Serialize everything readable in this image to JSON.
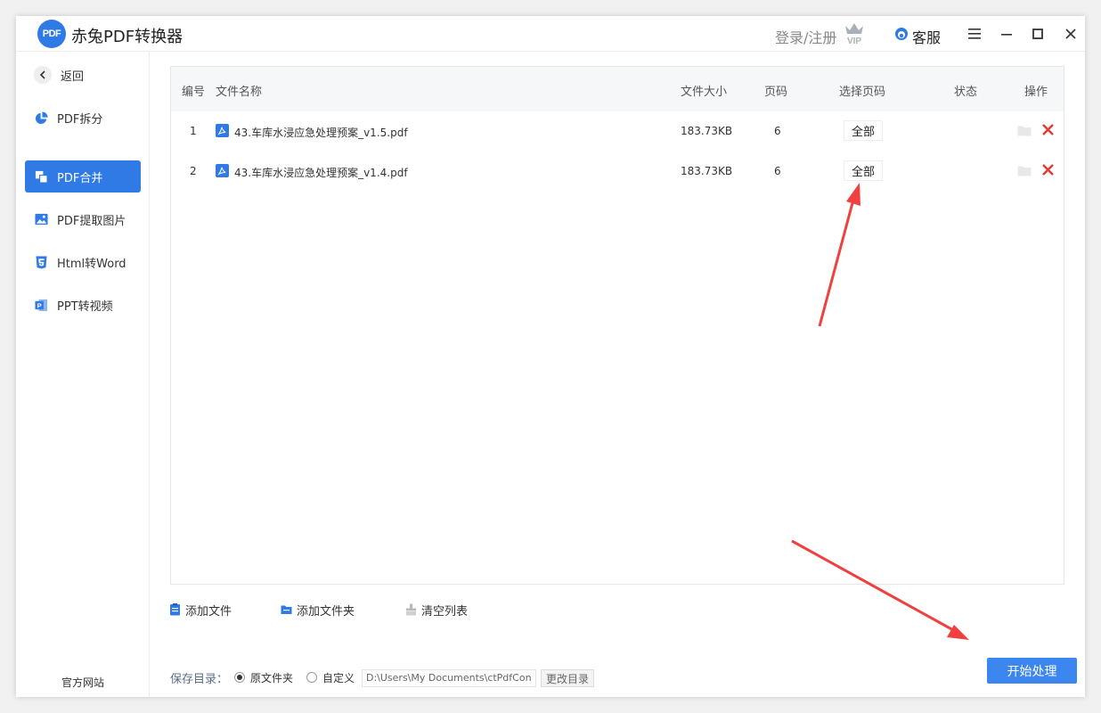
{
  "app": {
    "title": "赤兔PDF转换器",
    "logo_text": "PDF",
    "login_label": "登录/注册",
    "vip_label": "VIP",
    "service_label": "客服",
    "accent_color": "#2f7ae5"
  },
  "sidebar": {
    "back_label": "返回",
    "items": [
      {
        "label": "PDF拆分",
        "icon": "pie-chart-icon",
        "active": false
      },
      {
        "label": "PDF合并",
        "icon": "merge-icon",
        "active": true
      },
      {
        "label": "PDF提取图片",
        "icon": "image-icon",
        "active": false
      },
      {
        "label": "Html转Word",
        "icon": "html5-icon",
        "active": false
      },
      {
        "label": "PPT转视频",
        "icon": "ppt-icon",
        "active": false
      }
    ],
    "website_label": "官方网站"
  },
  "table": {
    "headers": {
      "index": "编号",
      "name": "文件名称",
      "size": "文件大小",
      "pages": "页码",
      "select_pages": "选择页码",
      "status": "状态",
      "actions": "操作"
    },
    "rows": [
      {
        "index": "1",
        "name": "43.车库水浸应急处理预案_v1.5.pdf",
        "size": "183.73KB",
        "pages": "6",
        "select": "全部",
        "status": ""
      },
      {
        "index": "2",
        "name": "43.车库水浸应急处理预案_v1.4.pdf",
        "size": "183.73KB",
        "pages": "6",
        "select": "全部",
        "status": ""
      }
    ]
  },
  "toolbar": {
    "add_file": "添加文件",
    "add_folder": "添加文件夹",
    "clear_list": "清空列表"
  },
  "footer": {
    "save_dir_label": "保存目录：",
    "option_original": "原文件夹",
    "option_custom": "自定义",
    "path_value": "D:\\Users\\My Documents\\ctPdfCon",
    "change_dir": "更改目录",
    "start_button": "开始处理"
  },
  "annotation_color": "#f04040"
}
